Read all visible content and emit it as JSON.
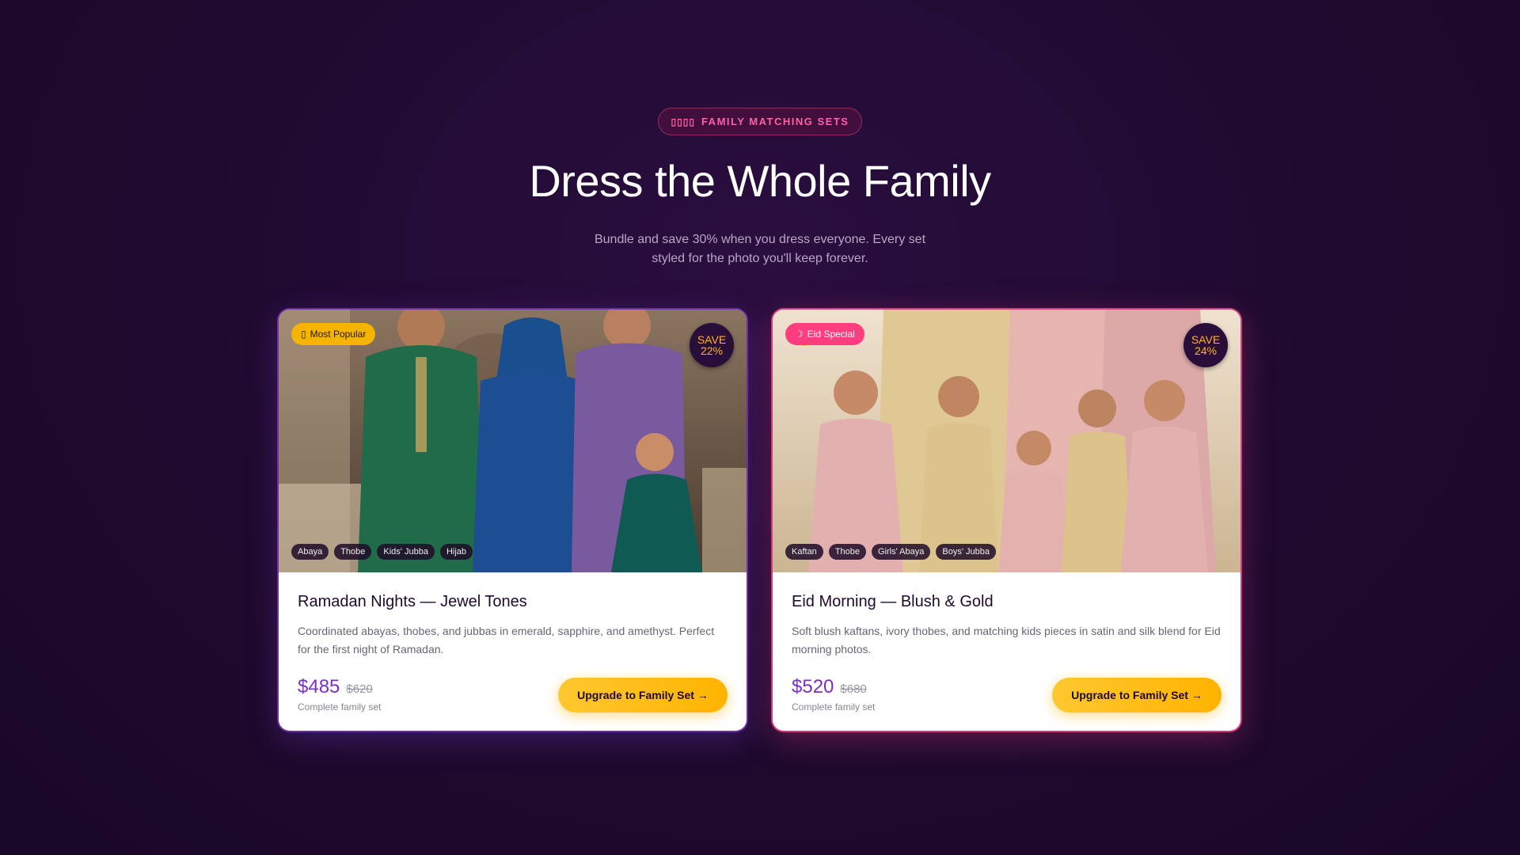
{
  "hero": {
    "pill_icons": "▯▯▯▯",
    "pill_label": "FAMILY MATCHING SETS",
    "title": "Dress the Whole Family",
    "subtitle": "Bundle and save 30% when you dress everyone. Every set styled for the photo you'll keep forever."
  },
  "cards": [
    {
      "badge_icon": "▯",
      "badge": "Most Popular",
      "save_label": "SAVE",
      "save_pct": "22%",
      "tags": [
        "Abaya",
        "Thobe",
        "Kids' Jubba",
        "Hijab"
      ],
      "title": "Ramadan Nights — Jewel Tones",
      "description": "Coordinated abayas, thobes, and jubbas in emerald, sapphire, and amethyst. Perfect for the first night of Ramadan.",
      "price": "$485",
      "old_price": "$620",
      "price_note": "Complete family set",
      "cta": "Upgrade to Family Set →"
    },
    {
      "badge_icon": "☽",
      "badge": "Eid Special",
      "save_label": "SAVE",
      "save_pct": "24%",
      "tags": [
        "Kaftan",
        "Thobe",
        "Girls' Abaya",
        "Boys' Jubba"
      ],
      "title": "Eid Morning — Blush & Gold",
      "description": "Soft blush kaftans, ivory thobes, and matching kids pieces in satin and silk blend for Eid morning photos.",
      "price": "$520",
      "old_price": "$680",
      "price_note": "Complete family set",
      "cta": "Upgrade to Family Set →"
    }
  ],
  "colors": {
    "background": "#1e0a2e",
    "accent_pink": "#ff5fa8",
    "price_purple": "#7b2fc9",
    "cta_gold": "#ffc830"
  }
}
